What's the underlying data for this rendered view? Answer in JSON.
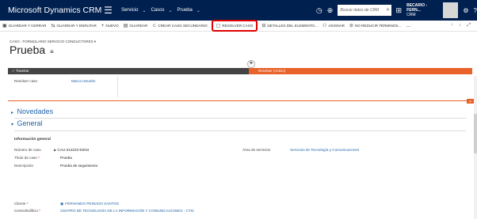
{
  "nav": {
    "brand": "Microsoft Dynamics CRM",
    "menu_icon": "hamburger-icon",
    "items": [
      {
        "label": "Servicio"
      },
      {
        "label": "Casos"
      },
      {
        "label": "Prueba"
      }
    ],
    "search_placeholder": "Buscar datos de CRM",
    "user_name": "BECARIO - FERN...",
    "user_org": "CRM"
  },
  "commands": [
    {
      "label": "GUARDAR Y CERRAR",
      "icon": "save-close-icon"
    },
    {
      "label": "GUARDAR Y ENRUTAR",
      "icon": "route-icon"
    },
    {
      "label": "NUEVO",
      "icon": "plus-icon"
    },
    {
      "label": "GUARDAR",
      "icon": "save-icon"
    },
    {
      "label": "CREAR CASO SECUNDARIO",
      "icon": "child-case-icon"
    },
    {
      "label": "RESOLVER CASO",
      "icon": "resolve-icon",
      "highlighted": true
    },
    {
      "label": "DETALLES DEL ELEMENTO...",
      "icon": "details-icon"
    },
    {
      "label": "ASIGNAR",
      "icon": "assign-icon"
    },
    {
      "label": "NO REDUCIR TÉRMINOS...",
      "icon": "no-reduce-icon"
    },
    {
      "label": "...",
      "icon": "more-icon"
    }
  ],
  "header": {
    "form_selector": "CASO : FORMULARIO SERVICIO CONDUCTORES",
    "title": "Prueba"
  },
  "process": {
    "left_stage": "Tramitar",
    "right_stage": "Resolver (Activo)",
    "field_label": "Resolver caso",
    "field_value": "Marca resuelto"
  },
  "sections": {
    "novedades": "Novedades",
    "general": "General",
    "group_title": "Información general"
  },
  "fields": {
    "case_number_label": "Número de caso",
    "case_number_value": "CAU-314223-D2N4",
    "case_title_label": "Título de caso",
    "case_title_value": "Prueba",
    "description_label": "Descripción",
    "description_value": "Prueba de seguimiento",
    "service_area_label": "Área de servicios",
    "service_area_value": "Servicios de Tecnología y Comunicaciones",
    "client_label": "Cliente",
    "client_value": "FERNANDO PEINADO SANTOS",
    "center_label": "Centro/Edificio",
    "center_value": "CENTRO DE TECNOLOGÍA DE LA INFORMACIÓN Y COMUNICACIONES - CTIC"
  },
  "colors": {
    "nav_bg": "#002050",
    "accent_orange": "#e8622a",
    "link_blue": "#2266aa",
    "highlight_red": "#e00000"
  }
}
